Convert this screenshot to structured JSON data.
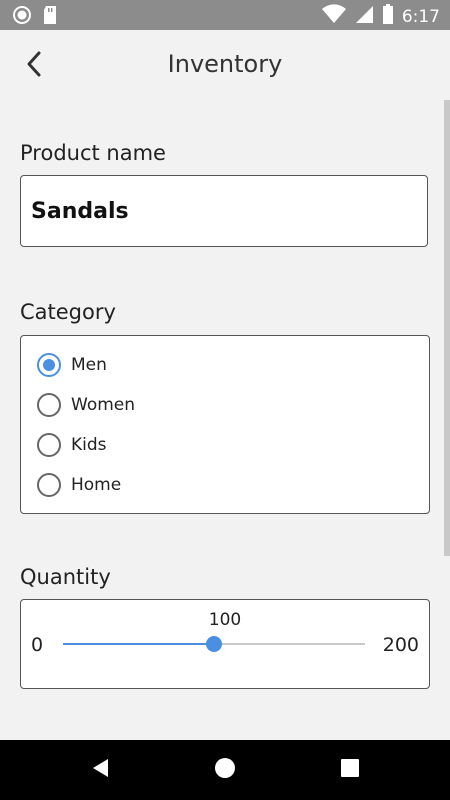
{
  "status_bar": {
    "time": "6:17",
    "icons": [
      "circle-icon",
      "sd-card-icon",
      "wifi-icon",
      "signal-icon",
      "battery-icon"
    ]
  },
  "app_bar": {
    "title": "Inventory",
    "back_icon": "back-arrow-icon"
  },
  "form": {
    "product_name": {
      "label": "Product name",
      "value": "Sandals"
    },
    "category": {
      "label": "Category",
      "options": [
        "Men",
        "Women",
        "Kids",
        "Home"
      ],
      "selected": "Men"
    },
    "quantity": {
      "label": "Quantity",
      "min": "0",
      "max": "200",
      "value": "100",
      "value_fraction": 0.5
    }
  },
  "colors": {
    "accent": "#4a8fe2",
    "status_bar": "#8c8c8c",
    "background": "#f2f2f2"
  },
  "nav_bar": {
    "icons": [
      "back-triangle-icon",
      "home-circle-icon",
      "recents-square-icon"
    ]
  }
}
